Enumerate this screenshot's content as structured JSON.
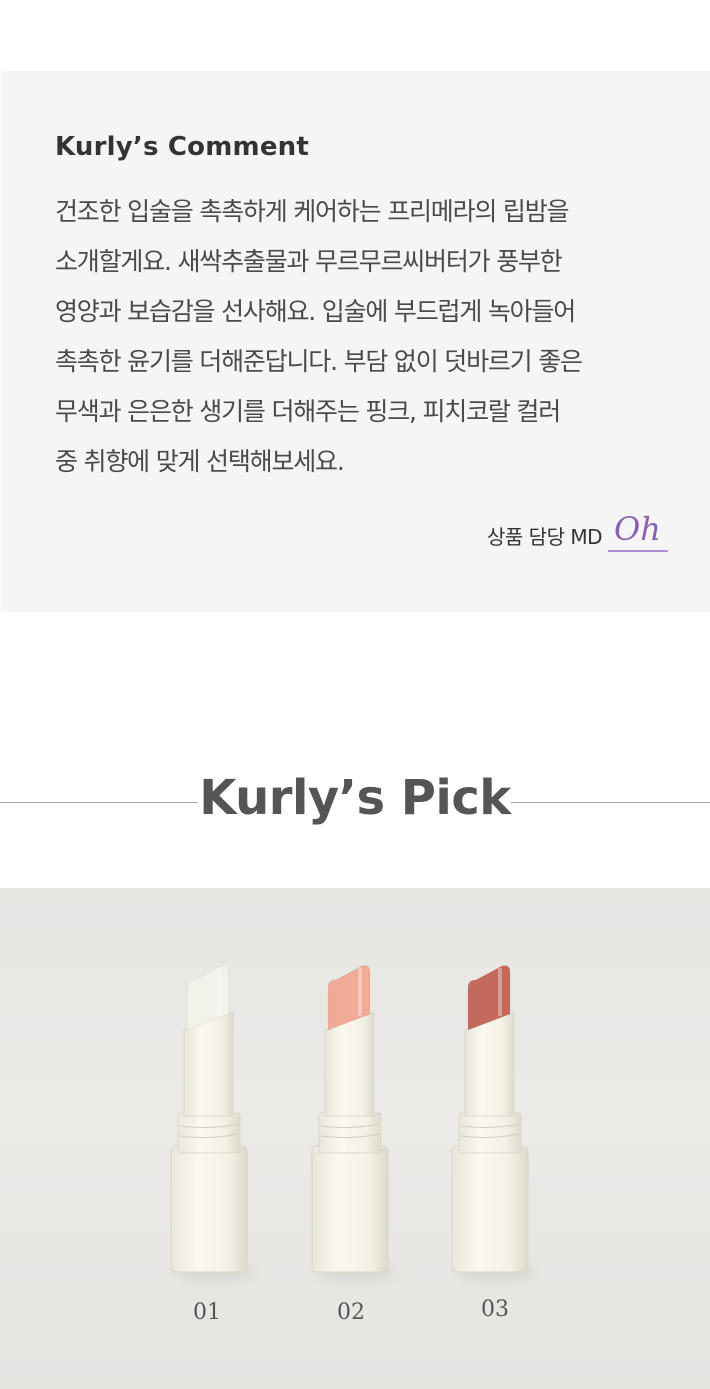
{
  "comment": {
    "title": "Kurly’s Comment",
    "lines": [
      "건조한 입술을 촉촉하게 케어하는 프리메라의 립밤을",
      "소개할게요. 새싹추출물과 무르무르씨버터가 풍부한",
      "영양과 보습감을 선사해요. 입술에 부드럽게 녹아들어",
      "촉촉한 윤기를 더해준답니다. 부담 없이 덧바르기 좋은",
      "무색과 은은한 생기를 더해주는 핑크, 피치코랄 컬러",
      "중 취향에 맞게 선택해보세요."
    ],
    "md_label": "상품 담당 MD",
    "md_name": "Oh"
  },
  "pick": {
    "title": "Kurly’s Pick"
  },
  "products": [
    {
      "number": "01",
      "balm_color": "#f1f2ea"
    },
    {
      "number": "02",
      "balm_color": "#f0aa95"
    },
    {
      "number": "03",
      "balm_color": "#c46a5c"
    }
  ],
  "colors": {
    "panel_bg": "#f5f5f5",
    "signature_underline": "#b08fd0"
  }
}
